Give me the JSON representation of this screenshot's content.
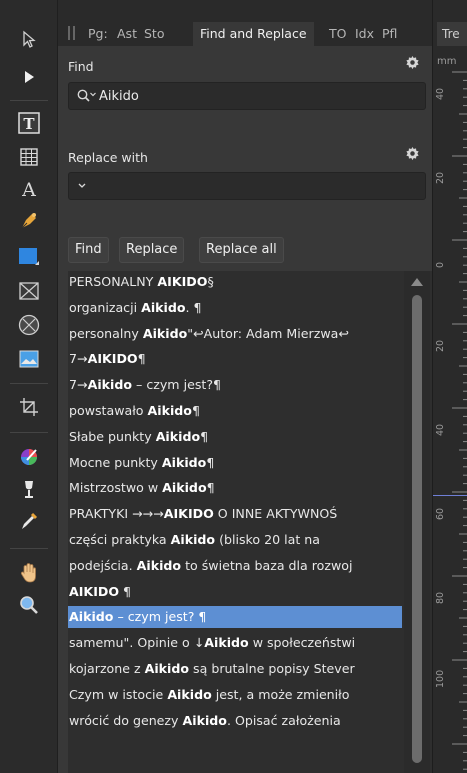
{
  "tabs": [
    {
      "label": "Pg:"
    },
    {
      "label": "Ast"
    },
    {
      "label": "Sto"
    },
    {
      "label": "Find and Replace",
      "active": true
    },
    {
      "label": "TO"
    },
    {
      "label": "Idx"
    },
    {
      "label": "Pfl"
    }
  ],
  "ruler": {
    "tab_label": "Tre",
    "unit": "mm",
    "ticks": [
      "40",
      "20",
      "0",
      "20",
      "40",
      "60",
      "80",
      "100"
    ]
  },
  "find": {
    "label": "Find",
    "value": "Aikido",
    "icon": "search-dropdown-icon"
  },
  "replace": {
    "label": "Replace with",
    "value": "",
    "icon": "dropdown-icon"
  },
  "buttons": {
    "find": "Find",
    "replace": "Replace",
    "replace_all": "Replace all"
  },
  "results": [
    {
      "pre": "PERSONALNY ",
      "match": "AIKIDO",
      "post": "§"
    },
    {
      "pre": "organizacji ",
      "match": "Aikido",
      "post": ". ¶"
    },
    {
      "pre": "personalny ",
      "match": "Aikido",
      "post": "\"↩Autor: Adam Mierzwa↩"
    },
    {
      "pre": "7→",
      "match": "AIKIDO",
      "post": "¶"
    },
    {
      "pre": "7→",
      "match": "Aikido",
      "post": " – czym jest?¶"
    },
    {
      "pre": "powstawało ",
      "match": "Aikido",
      "post": "¶"
    },
    {
      "pre": "Słabe punkty ",
      "match": "Aikido",
      "post": "¶"
    },
    {
      "pre": "Mocne punkty ",
      "match": "Aikido",
      "post": "¶"
    },
    {
      "pre": "Mistrzostwo w ",
      "match": "Aikido",
      "post": "¶"
    },
    {
      "pre": "PRAKTYKI →→→",
      "match": "AIKIDO",
      "post": " O INNE AKTYWNOŚ"
    },
    {
      "pre": "części praktyka ",
      "match": "Aikido",
      "post": " (blisko 20 lat na"
    },
    {
      "pre": "podejścia. ",
      "match": "Aikido",
      "post": " to świetna baza dla rozwoj"
    },
    {
      "pre": "",
      "match": "AIKIDO",
      "post": " ¶"
    },
    {
      "pre": "",
      "match": "Aikido",
      "post": " – czym jest? ¶",
      "selected": true
    },
    {
      "pre": "samemu\". Opinie o ↓",
      "match": "Aikido",
      "post": " w społeczeństwi"
    },
    {
      "pre": "kojarzone z ",
      "match": "Aikido",
      "post": " są brutalne popisy Stever"
    },
    {
      "pre": "Czym w istocie ",
      "match": "Aikido",
      "post": " jest, a może zmieniło"
    },
    {
      "pre": "wrócić do genezy ",
      "match": "Aikido",
      "post": ". Opisać założenia"
    }
  ],
  "tools": [
    "move-tool-icon",
    "node-tool-icon",
    "frame-text-tool-icon",
    "table-tool-icon",
    "artistic-text-tool-icon",
    "pen-tool-icon",
    "rectangle-tool-icon",
    "picture-frame-tool-icon",
    "ellipse-frame-tool-icon",
    "place-image-tool-icon",
    "crop-tool-icon",
    "color-picker-wheel-icon",
    "fill-tool-icon",
    "eyedropper-tool-icon",
    "hand-tool-icon",
    "zoom-tool-icon"
  ],
  "colors": {
    "selection": "#5d8fd3",
    "panel": "#383838",
    "ruler_marker": "#6f7fd6"
  }
}
